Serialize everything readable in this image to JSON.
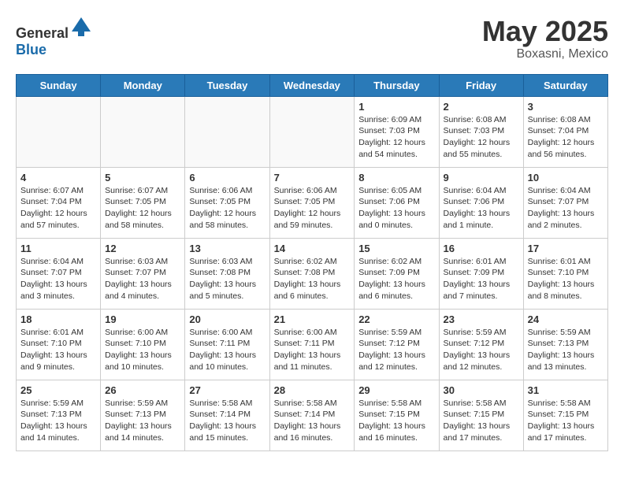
{
  "header": {
    "logo_general": "General",
    "logo_blue": "Blue",
    "month_title": "May 2025",
    "location": "Boxasni, Mexico"
  },
  "weekdays": [
    "Sunday",
    "Monday",
    "Tuesday",
    "Wednesday",
    "Thursday",
    "Friday",
    "Saturday"
  ],
  "weeks": [
    [
      {
        "day": "",
        "info": ""
      },
      {
        "day": "",
        "info": ""
      },
      {
        "day": "",
        "info": ""
      },
      {
        "day": "",
        "info": ""
      },
      {
        "day": "1",
        "info": "Sunrise: 6:09 AM\nSunset: 7:03 PM\nDaylight: 12 hours and 54 minutes."
      },
      {
        "day": "2",
        "info": "Sunrise: 6:08 AM\nSunset: 7:03 PM\nDaylight: 12 hours and 55 minutes."
      },
      {
        "day": "3",
        "info": "Sunrise: 6:08 AM\nSunset: 7:04 PM\nDaylight: 12 hours and 56 minutes."
      }
    ],
    [
      {
        "day": "4",
        "info": "Sunrise: 6:07 AM\nSunset: 7:04 PM\nDaylight: 12 hours and 57 minutes."
      },
      {
        "day": "5",
        "info": "Sunrise: 6:07 AM\nSunset: 7:05 PM\nDaylight: 12 hours and 58 minutes."
      },
      {
        "day": "6",
        "info": "Sunrise: 6:06 AM\nSunset: 7:05 PM\nDaylight: 12 hours and 58 minutes."
      },
      {
        "day": "7",
        "info": "Sunrise: 6:06 AM\nSunset: 7:05 PM\nDaylight: 12 hours and 59 minutes."
      },
      {
        "day": "8",
        "info": "Sunrise: 6:05 AM\nSunset: 7:06 PM\nDaylight: 13 hours and 0 minutes."
      },
      {
        "day": "9",
        "info": "Sunrise: 6:04 AM\nSunset: 7:06 PM\nDaylight: 13 hours and 1 minute."
      },
      {
        "day": "10",
        "info": "Sunrise: 6:04 AM\nSunset: 7:07 PM\nDaylight: 13 hours and 2 minutes."
      }
    ],
    [
      {
        "day": "11",
        "info": "Sunrise: 6:04 AM\nSunset: 7:07 PM\nDaylight: 13 hours and 3 minutes."
      },
      {
        "day": "12",
        "info": "Sunrise: 6:03 AM\nSunset: 7:07 PM\nDaylight: 13 hours and 4 minutes."
      },
      {
        "day": "13",
        "info": "Sunrise: 6:03 AM\nSunset: 7:08 PM\nDaylight: 13 hours and 5 minutes."
      },
      {
        "day": "14",
        "info": "Sunrise: 6:02 AM\nSunset: 7:08 PM\nDaylight: 13 hours and 6 minutes."
      },
      {
        "day": "15",
        "info": "Sunrise: 6:02 AM\nSunset: 7:09 PM\nDaylight: 13 hours and 6 minutes."
      },
      {
        "day": "16",
        "info": "Sunrise: 6:01 AM\nSunset: 7:09 PM\nDaylight: 13 hours and 7 minutes."
      },
      {
        "day": "17",
        "info": "Sunrise: 6:01 AM\nSunset: 7:10 PM\nDaylight: 13 hours and 8 minutes."
      }
    ],
    [
      {
        "day": "18",
        "info": "Sunrise: 6:01 AM\nSunset: 7:10 PM\nDaylight: 13 hours and 9 minutes."
      },
      {
        "day": "19",
        "info": "Sunrise: 6:00 AM\nSunset: 7:10 PM\nDaylight: 13 hours and 10 minutes."
      },
      {
        "day": "20",
        "info": "Sunrise: 6:00 AM\nSunset: 7:11 PM\nDaylight: 13 hours and 10 minutes."
      },
      {
        "day": "21",
        "info": "Sunrise: 6:00 AM\nSunset: 7:11 PM\nDaylight: 13 hours and 11 minutes."
      },
      {
        "day": "22",
        "info": "Sunrise: 5:59 AM\nSunset: 7:12 PM\nDaylight: 13 hours and 12 minutes."
      },
      {
        "day": "23",
        "info": "Sunrise: 5:59 AM\nSunset: 7:12 PM\nDaylight: 13 hours and 12 minutes."
      },
      {
        "day": "24",
        "info": "Sunrise: 5:59 AM\nSunset: 7:13 PM\nDaylight: 13 hours and 13 minutes."
      }
    ],
    [
      {
        "day": "25",
        "info": "Sunrise: 5:59 AM\nSunset: 7:13 PM\nDaylight: 13 hours and 14 minutes."
      },
      {
        "day": "26",
        "info": "Sunrise: 5:59 AM\nSunset: 7:13 PM\nDaylight: 13 hours and 14 minutes."
      },
      {
        "day": "27",
        "info": "Sunrise: 5:58 AM\nSunset: 7:14 PM\nDaylight: 13 hours and 15 minutes."
      },
      {
        "day": "28",
        "info": "Sunrise: 5:58 AM\nSunset: 7:14 PM\nDaylight: 13 hours and 16 minutes."
      },
      {
        "day": "29",
        "info": "Sunrise: 5:58 AM\nSunset: 7:15 PM\nDaylight: 13 hours and 16 minutes."
      },
      {
        "day": "30",
        "info": "Sunrise: 5:58 AM\nSunset: 7:15 PM\nDaylight: 13 hours and 17 minutes."
      },
      {
        "day": "31",
        "info": "Sunrise: 5:58 AM\nSunset: 7:15 PM\nDaylight: 13 hours and 17 minutes."
      }
    ]
  ]
}
